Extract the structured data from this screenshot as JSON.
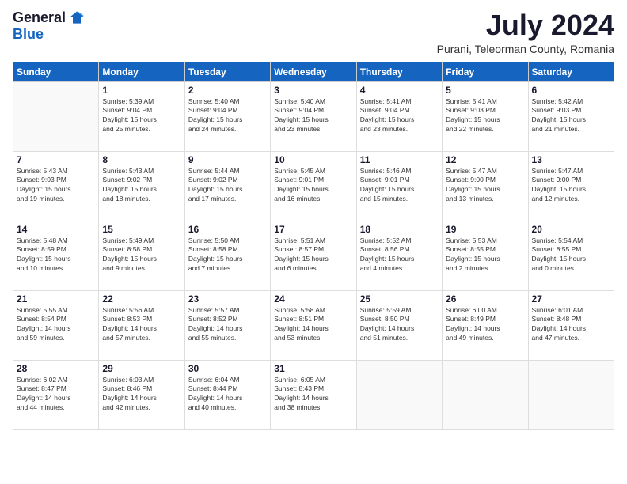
{
  "logo": {
    "general": "General",
    "blue": "Blue"
  },
  "header": {
    "month_year": "July 2024",
    "location": "Purani, Teleorman County, Romania"
  },
  "weekdays": [
    "Sunday",
    "Monday",
    "Tuesday",
    "Wednesday",
    "Thursday",
    "Friday",
    "Saturday"
  ],
  "weeks": [
    [
      {
        "day": "",
        "info": ""
      },
      {
        "day": "1",
        "info": "Sunrise: 5:39 AM\nSunset: 9:04 PM\nDaylight: 15 hours\nand 25 minutes."
      },
      {
        "day": "2",
        "info": "Sunrise: 5:40 AM\nSunset: 9:04 PM\nDaylight: 15 hours\nand 24 minutes."
      },
      {
        "day": "3",
        "info": "Sunrise: 5:40 AM\nSunset: 9:04 PM\nDaylight: 15 hours\nand 23 minutes."
      },
      {
        "day": "4",
        "info": "Sunrise: 5:41 AM\nSunset: 9:04 PM\nDaylight: 15 hours\nand 23 minutes."
      },
      {
        "day": "5",
        "info": "Sunrise: 5:41 AM\nSunset: 9:03 PM\nDaylight: 15 hours\nand 22 minutes."
      },
      {
        "day": "6",
        "info": "Sunrise: 5:42 AM\nSunset: 9:03 PM\nDaylight: 15 hours\nand 21 minutes."
      }
    ],
    [
      {
        "day": "7",
        "info": "Sunrise: 5:43 AM\nSunset: 9:03 PM\nDaylight: 15 hours\nand 19 minutes."
      },
      {
        "day": "8",
        "info": "Sunrise: 5:43 AM\nSunset: 9:02 PM\nDaylight: 15 hours\nand 18 minutes."
      },
      {
        "day": "9",
        "info": "Sunrise: 5:44 AM\nSunset: 9:02 PM\nDaylight: 15 hours\nand 17 minutes."
      },
      {
        "day": "10",
        "info": "Sunrise: 5:45 AM\nSunset: 9:01 PM\nDaylight: 15 hours\nand 16 minutes."
      },
      {
        "day": "11",
        "info": "Sunrise: 5:46 AM\nSunset: 9:01 PM\nDaylight: 15 hours\nand 15 minutes."
      },
      {
        "day": "12",
        "info": "Sunrise: 5:47 AM\nSunset: 9:00 PM\nDaylight: 15 hours\nand 13 minutes."
      },
      {
        "day": "13",
        "info": "Sunrise: 5:47 AM\nSunset: 9:00 PM\nDaylight: 15 hours\nand 12 minutes."
      }
    ],
    [
      {
        "day": "14",
        "info": "Sunrise: 5:48 AM\nSunset: 8:59 PM\nDaylight: 15 hours\nand 10 minutes."
      },
      {
        "day": "15",
        "info": "Sunrise: 5:49 AM\nSunset: 8:58 PM\nDaylight: 15 hours\nand 9 minutes."
      },
      {
        "day": "16",
        "info": "Sunrise: 5:50 AM\nSunset: 8:58 PM\nDaylight: 15 hours\nand 7 minutes."
      },
      {
        "day": "17",
        "info": "Sunrise: 5:51 AM\nSunset: 8:57 PM\nDaylight: 15 hours\nand 6 minutes."
      },
      {
        "day": "18",
        "info": "Sunrise: 5:52 AM\nSunset: 8:56 PM\nDaylight: 15 hours\nand 4 minutes."
      },
      {
        "day": "19",
        "info": "Sunrise: 5:53 AM\nSunset: 8:55 PM\nDaylight: 15 hours\nand 2 minutes."
      },
      {
        "day": "20",
        "info": "Sunrise: 5:54 AM\nSunset: 8:55 PM\nDaylight: 15 hours\nand 0 minutes."
      }
    ],
    [
      {
        "day": "21",
        "info": "Sunrise: 5:55 AM\nSunset: 8:54 PM\nDaylight: 14 hours\nand 59 minutes."
      },
      {
        "day": "22",
        "info": "Sunrise: 5:56 AM\nSunset: 8:53 PM\nDaylight: 14 hours\nand 57 minutes."
      },
      {
        "day": "23",
        "info": "Sunrise: 5:57 AM\nSunset: 8:52 PM\nDaylight: 14 hours\nand 55 minutes."
      },
      {
        "day": "24",
        "info": "Sunrise: 5:58 AM\nSunset: 8:51 PM\nDaylight: 14 hours\nand 53 minutes."
      },
      {
        "day": "25",
        "info": "Sunrise: 5:59 AM\nSunset: 8:50 PM\nDaylight: 14 hours\nand 51 minutes."
      },
      {
        "day": "26",
        "info": "Sunrise: 6:00 AM\nSunset: 8:49 PM\nDaylight: 14 hours\nand 49 minutes."
      },
      {
        "day": "27",
        "info": "Sunrise: 6:01 AM\nSunset: 8:48 PM\nDaylight: 14 hours\nand 47 minutes."
      }
    ],
    [
      {
        "day": "28",
        "info": "Sunrise: 6:02 AM\nSunset: 8:47 PM\nDaylight: 14 hours\nand 44 minutes."
      },
      {
        "day": "29",
        "info": "Sunrise: 6:03 AM\nSunset: 8:46 PM\nDaylight: 14 hours\nand 42 minutes."
      },
      {
        "day": "30",
        "info": "Sunrise: 6:04 AM\nSunset: 8:44 PM\nDaylight: 14 hours\nand 40 minutes."
      },
      {
        "day": "31",
        "info": "Sunrise: 6:05 AM\nSunset: 8:43 PM\nDaylight: 14 hours\nand 38 minutes."
      },
      {
        "day": "",
        "info": ""
      },
      {
        "day": "",
        "info": ""
      },
      {
        "day": "",
        "info": ""
      }
    ]
  ]
}
